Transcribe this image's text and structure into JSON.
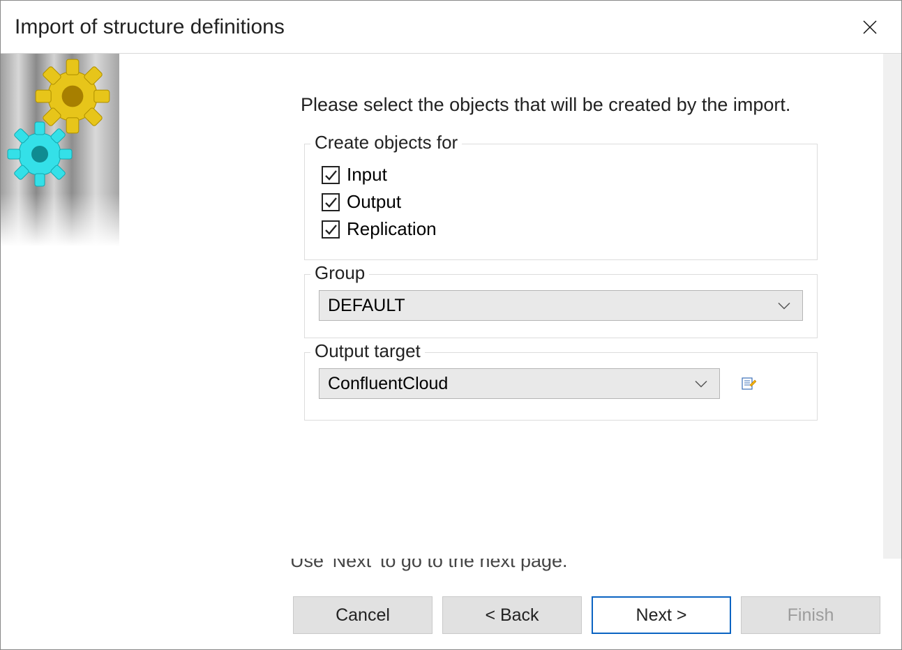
{
  "dialog": {
    "title": "Import of structure definitions",
    "instruction": "Please select the objects that will be created by the import.",
    "hint": "Use 'Next' to go to the next page."
  },
  "create_objects": {
    "legend": "Create objects for",
    "items": [
      {
        "label": "Input",
        "checked": true
      },
      {
        "label": "Output",
        "checked": true
      },
      {
        "label": "Replication",
        "checked": true
      }
    ]
  },
  "group": {
    "legend": "Group",
    "value": "DEFAULT"
  },
  "output_target": {
    "legend": "Output target",
    "value": "ConfluentCloud"
  },
  "buttons": {
    "cancel": "Cancel",
    "back": "< Back",
    "next": "Next >",
    "finish": "Finish"
  }
}
